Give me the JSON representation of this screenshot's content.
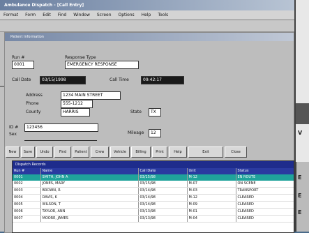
{
  "window": {
    "title": "Ambulance Dispatch - [Call Entry]",
    "menu": [
      "Format",
      "Form",
      "Edit",
      "Find",
      "Window",
      "Screen",
      "Options",
      "Help",
      "Tools"
    ]
  },
  "panel": {
    "title": "Patient Information"
  },
  "form": {
    "run_label": "Run #",
    "run_value": "0001",
    "response_label": "Response Type",
    "response_value": "EMERGENCY RESPONSE",
    "date_label": "Call Date",
    "date_value": "03/15/1998",
    "time_label": "Call Time",
    "time_value": "09:42:17",
    "address_label": "Address",
    "address_value": "1234 MAIN STREET",
    "phone_label": "Phone",
    "phone_value": "555-1212",
    "county_label": "County",
    "county_value": "HARRIS",
    "state_label": "State",
    "state_value": "TX",
    "id_label": "ID #",
    "sex_label": "Sex",
    "id_value": "123456",
    "mileage_label": "Mileage",
    "mileage_value": "12"
  },
  "buttons": [
    "New",
    "Save",
    "Undo",
    "Find",
    "Patient",
    "Crew",
    "Vehicle",
    "Billing",
    "Print",
    "Help",
    "Exit",
    "Close"
  ],
  "grid": {
    "title": "Dispatch Records",
    "columns": [
      "Run #",
      "Name",
      "Call Date",
      "Unit",
      "Status"
    ],
    "rows": [
      {
        "cells": [
          "0001",
          "SMITH, JOHN A",
          "03/15/98",
          "M-12",
          "EN ROUTE"
        ],
        "selected": true
      },
      {
        "cells": [
          "0002",
          "JONES, MARY",
          "03/15/98",
          "M-07",
          "ON SCENE"
        ],
        "selected": false
      },
      {
        "cells": [
          "0003",
          "BROWN, R",
          "03/14/98",
          "M-03",
          "TRANSPORT"
        ],
        "selected": false
      },
      {
        "cells": [
          "0004",
          "DAVIS, K",
          "03/14/98",
          "M-12",
          "CLEARED"
        ],
        "selected": false
      },
      {
        "cells": [
          "0005",
          "WILSON, T",
          "03/14/98",
          "M-09",
          "CLEARED"
        ],
        "selected": false
      },
      {
        "cells": [
          "0006",
          "TAYLOR, ANN",
          "03/13/98",
          "M-01",
          "CLEARED"
        ],
        "selected": false
      },
      {
        "cells": [
          "0007",
          "MOORE, JAMES",
          "03/13/98",
          "M-04",
          "CLEARED"
        ],
        "selected": false
      }
    ]
  },
  "side": {
    "letters": [
      "V",
      "E",
      "E",
      "E"
    ]
  }
}
